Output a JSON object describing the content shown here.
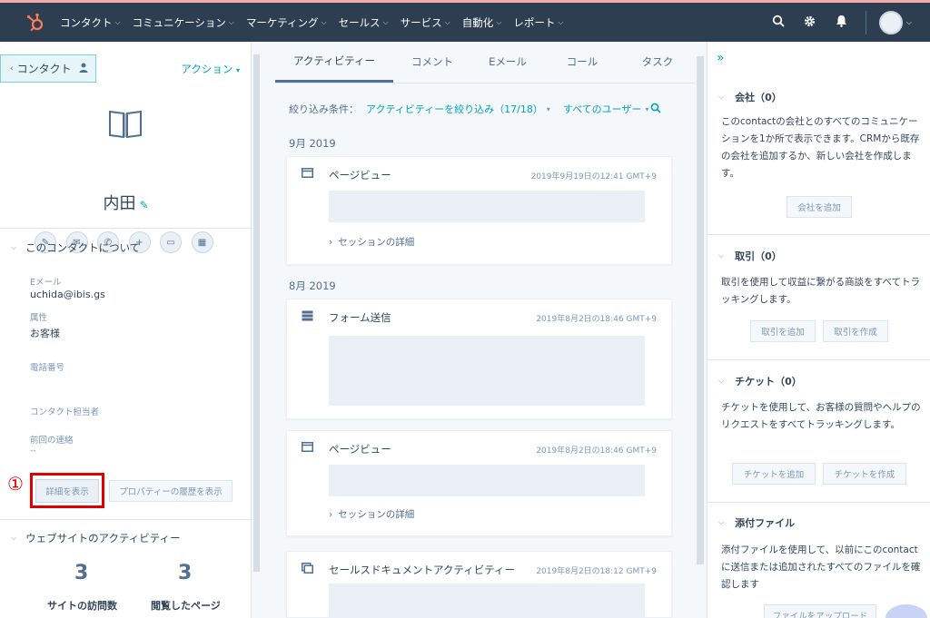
{
  "nav": {
    "logo_icon": "hubspot-sprocket-icon",
    "items": [
      {
        "label": "コンタクト"
      },
      {
        "label": "コミュニケーション"
      },
      {
        "label": "マーケティング"
      },
      {
        "label": "セールス"
      },
      {
        "label": "サービス"
      },
      {
        "label": "自動化"
      },
      {
        "label": "レポート"
      }
    ],
    "icons": [
      "search-icon",
      "gear-icon",
      "bell-icon"
    ]
  },
  "left": {
    "back_label": "コンタクト",
    "action_label": "アクション",
    "contact_name": "内田",
    "about_title": "このコンタクトについて",
    "props": [
      {
        "label": "Eメール",
        "value": "uchida@ibis.gs"
      },
      {
        "label": "属性",
        "value": "お客様"
      },
      {
        "label": "電話番号",
        "value": ""
      },
      {
        "label": "コンタクト担当者",
        "value": ""
      },
      {
        "label": "前回の連絡",
        "value": "--"
      }
    ],
    "annotation_marker": "①",
    "detail_button": "詳細を表示",
    "history_button": "プロパティーの履歴を表示",
    "website_title": "ウェブサイトのアクティビティー",
    "stats": [
      {
        "num": "3",
        "label": "サイトの訪問数"
      },
      {
        "num": "3",
        "label": "閲覧したページ"
      }
    ]
  },
  "mid": {
    "tabs": [
      {
        "label": "アクティビティー"
      },
      {
        "label": "コメント"
      },
      {
        "label": "Eメール"
      },
      {
        "label": "コール"
      },
      {
        "label": "タスク"
      }
    ],
    "filter_label": "絞り込み条件：",
    "filter_activity": "アクティビティーを絞り込み（17/18）",
    "filter_users": "すべてのユーザー",
    "months": [
      "9月 2019",
      "8月 2019"
    ],
    "cards": [
      {
        "title": "ページビュー",
        "time": "2019年9月19日の12:41 GMT+9",
        "sub": "セッションの詳細"
      },
      {
        "title": "フォーム送信",
        "time": "2019年8月2日の18:46 GMT+9",
        "sub": ""
      },
      {
        "title": "ページビュー",
        "time": "2019年8月2日の18:46 GMT+9",
        "sub": "セッションの詳細"
      },
      {
        "title": "セールスドキュメントアクティビティー",
        "time": "2019年8月2日の18:12 GMT+9",
        "sub": ""
      }
    ]
  },
  "right": {
    "sections": [
      {
        "title": "会社（0）",
        "text": "このcontactの会社とのすべてのコミュニケーションを1か所で表示できます。CRMから既存の会社を追加するか、新しい会社を作成します。",
        "buttons": [
          "会社を追加"
        ]
      },
      {
        "title": "取引（0）",
        "text": "取引を使用して収益に繋がる商談をすべてトラッキングします。",
        "buttons": [
          "取引を追加",
          "取引を作成"
        ]
      },
      {
        "title": "チケット（0）",
        "text": "チケットを使用して、お客様の質問やヘルプのリクエストをすべてトラッキングします。",
        "buttons": [
          "チケットを追加",
          "チケットを作成"
        ]
      },
      {
        "title": "添付ファイル",
        "text": "添付ファイルを使用して、以前にこのcontactに送信または追加されたすべてのファイルを確認します",
        "buttons": [
          "ファイルをアップロード"
        ]
      }
    ]
  }
}
